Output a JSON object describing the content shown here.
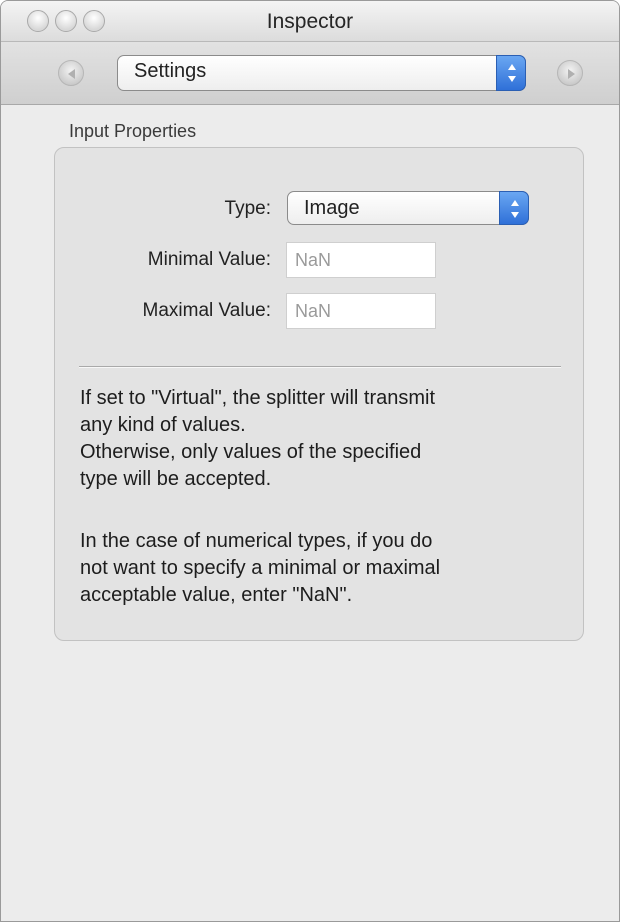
{
  "window": {
    "title": "Inspector"
  },
  "toolbar": {
    "popup_value": "Settings"
  },
  "section": {
    "title": "Input Properties",
    "type_label": "Type:",
    "type_value": "Image",
    "min_label": "Minimal Value:",
    "min_value": "NaN",
    "max_label": "Maximal Value:",
    "max_value": "NaN",
    "help_para1": [
      "If set to \"Virtual\", the splitter will transmit",
      "any kind of values.",
      "Otherwise, only values of the specified",
      "type will be accepted."
    ],
    "help_para2": [
      "In the case of numerical types, if you do",
      "not want to specify a minimal or maximal",
      "acceptable value, enter \"NaN\"."
    ]
  },
  "icons": [
    "close-icon",
    "minimize-icon",
    "zoom-icon",
    "back-arrow-icon",
    "forward-arrow-icon",
    "popup-arrows-icon"
  ]
}
